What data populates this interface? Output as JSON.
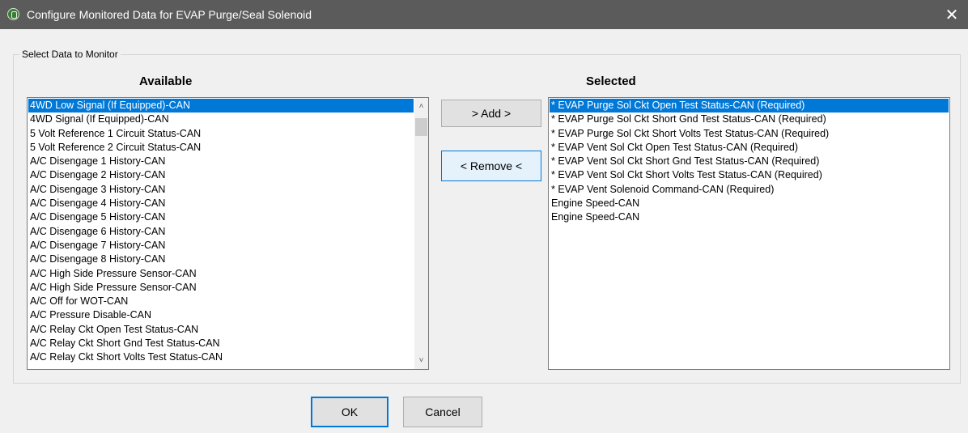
{
  "window": {
    "title": "Configure Monitored Data for EVAP Purge/Seal Solenoid",
    "close_glyph": "✕",
    "icon": "app-icon"
  },
  "group": {
    "label": "Select Data to Monitor"
  },
  "available": {
    "header": "Available",
    "items": [
      "4WD Low Signal (If Equipped)-CAN",
      "4WD Signal (If Equipped)-CAN",
      "5 Volt Reference 1 Circuit Status-CAN",
      "5 Volt Reference 2 Circuit Status-CAN",
      "A/C Disengage 1 History-CAN",
      "A/C Disengage 2 History-CAN",
      "A/C Disengage 3 History-CAN",
      "A/C Disengage 4 History-CAN",
      "A/C Disengage 5 History-CAN",
      "A/C Disengage 6 History-CAN",
      "A/C Disengage 7 History-CAN",
      "A/C Disengage 8 History-CAN",
      "A/C High Side Pressure Sensor-CAN",
      "A/C High Side Pressure Sensor-CAN",
      "A/C Off for WOT-CAN",
      "A/C Pressure Disable-CAN",
      "A/C Relay Ckt Open Test Status-CAN",
      "A/C Relay Ckt Short Gnd Test Status-CAN",
      "A/C Relay Ckt Short Volts Test Status-CAN"
    ],
    "selected_index": 0
  },
  "selected": {
    "header": "Selected",
    "items": [
      "* EVAP Purge Sol Ckt Open Test Status-CAN (Required)",
      "* EVAP Purge Sol Ckt Short Gnd Test Status-CAN (Required)",
      "* EVAP Purge Sol Ckt Short Volts Test Status-CAN (Required)",
      "* EVAP Vent Sol Ckt Open Test Status-CAN (Required)",
      "* EVAP Vent Sol Ckt Short Gnd Test Status-CAN (Required)",
      "* EVAP Vent Sol Ckt Short Volts Test Status-CAN (Required)",
      "* EVAP Vent Solenoid Command-CAN (Required)",
      "Engine Speed-CAN",
      "Engine Speed-CAN"
    ],
    "selected_index": 0
  },
  "buttons": {
    "add": "> Add >",
    "remove": "< Remove <",
    "ok": "OK",
    "cancel": "Cancel"
  },
  "colors": {
    "titlebar": "#5b5b5b",
    "selection": "#0078d7",
    "focus_border": "#0078d7"
  }
}
